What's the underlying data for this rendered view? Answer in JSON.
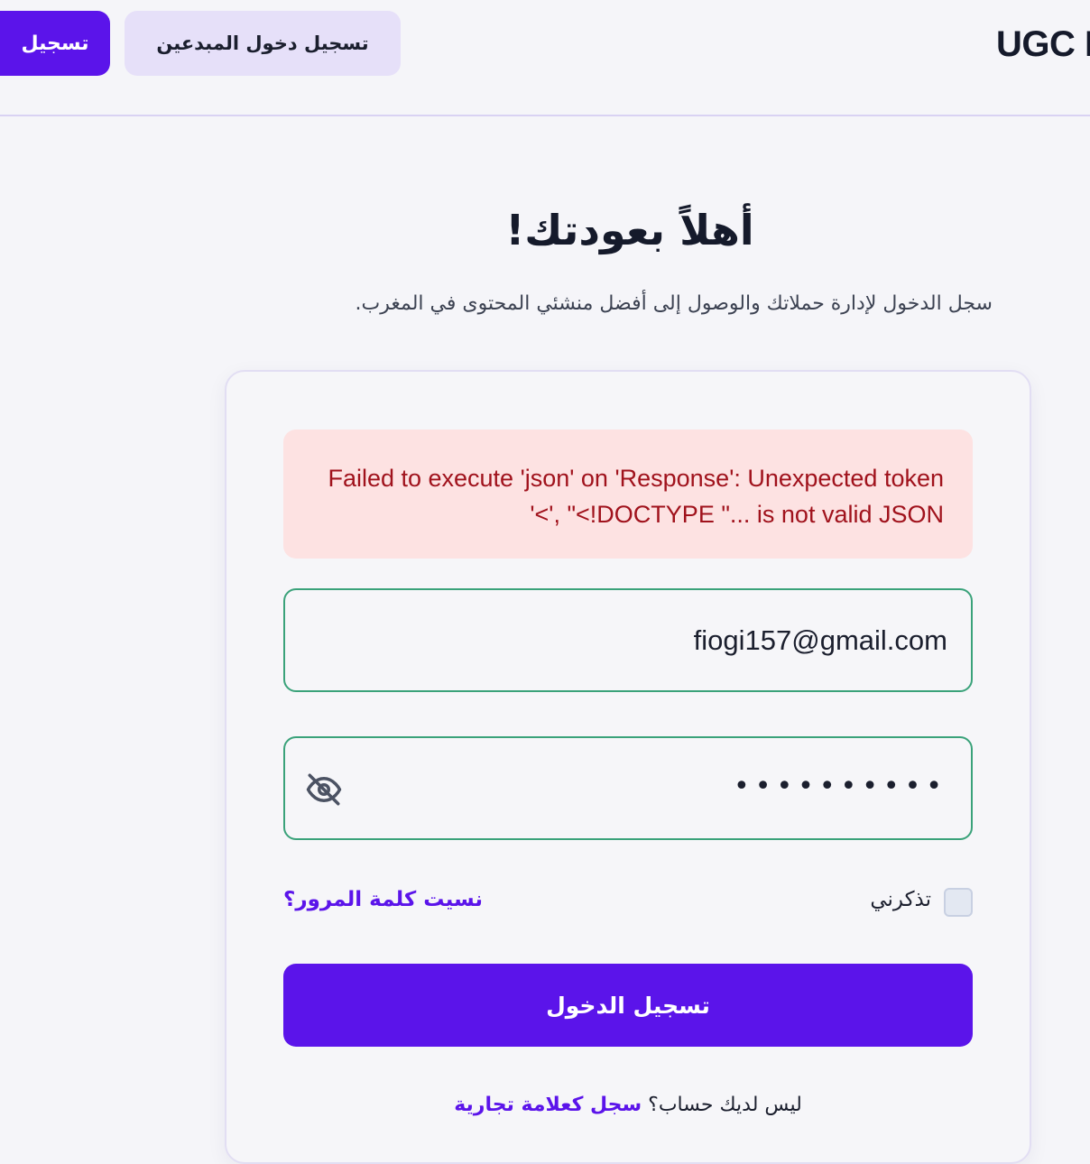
{
  "header": {
    "logo_text": "UGC M",
    "register_button_label": "تسجيل",
    "creator_login_button_label": "تسجيل دخول المبدعين"
  },
  "hero": {
    "title": "أهلاً بعودتك!",
    "subtitle": "سجل الدخول لإدارة حملاتك والوصول إلى أفضل منشئي المحتوى في المغرب."
  },
  "form": {
    "error_message": "Failed to execute 'json' on 'Response': Unexpected token '<', \"<!DOCTYPE \"... is not valid JSON",
    "email_value": "fiogi157@gmail.com",
    "password_masked": "••••••••••",
    "password_toggle_icon": "eye-off-icon",
    "remember_me_label": "تذكرني",
    "remember_me_checked": false,
    "forgot_password_label": "نسيت كلمة المرور؟",
    "submit_label": "تسجيل الدخول",
    "no_account_text": "ليس لديك حساب؟",
    "register_brand_link": "سجل كعلامة تجارية"
  },
  "colors": {
    "primary": "#5b14ea",
    "primary_soft": "#e6e0f9",
    "error_bg": "#fde2e2",
    "error_text": "#a0121c",
    "valid_border": "#3aa27a",
    "background": "#f5f5f9"
  }
}
